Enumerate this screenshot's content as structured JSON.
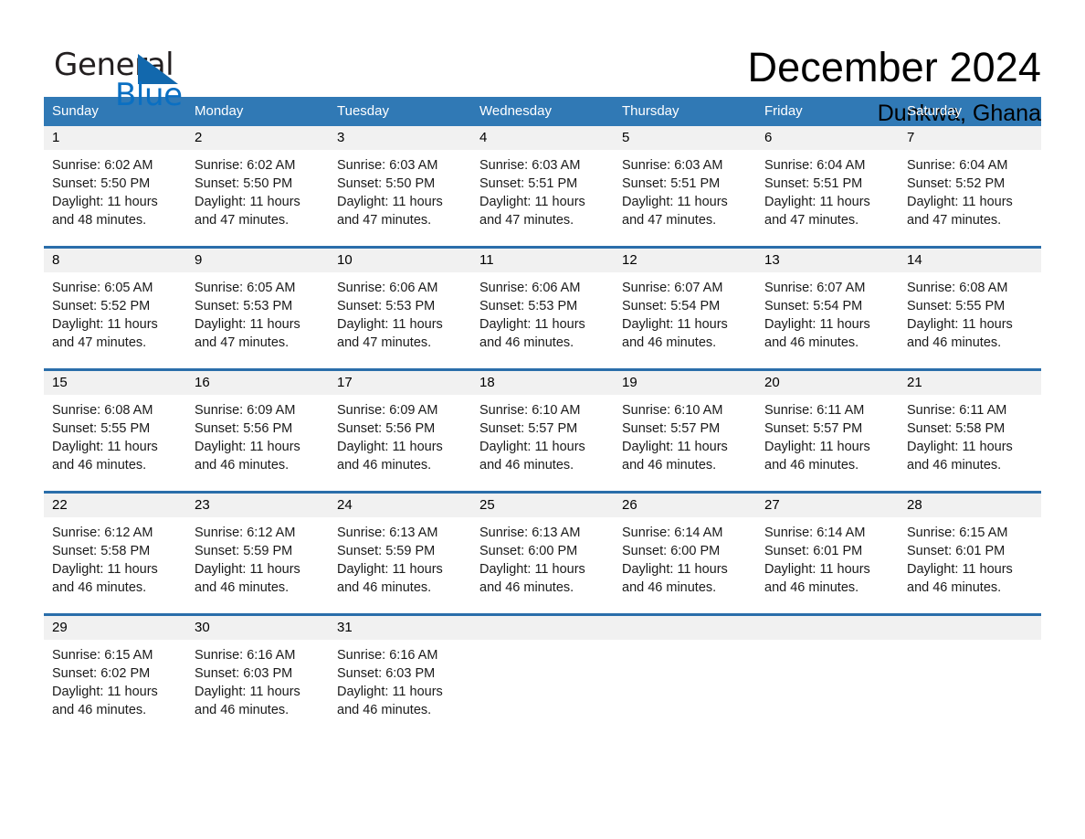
{
  "logo": {
    "text_primary": "General",
    "text_secondary": "Blue",
    "triangle_color": "#1268ad",
    "secondary_color": "#0a6fc2"
  },
  "header": {
    "title": "December 2024",
    "subtitle": "Dunkwa, Ghana"
  },
  "theme": {
    "header_blue": "#3079b5",
    "row_divider_blue": "#2a6eaa",
    "day_band_gray": "#f1f1f1"
  },
  "calendar": {
    "weekdays": [
      "Sunday",
      "Monday",
      "Tuesday",
      "Wednesday",
      "Thursday",
      "Friday",
      "Saturday"
    ],
    "weeks": [
      [
        {
          "day": "1",
          "sunrise": "Sunrise: 6:02 AM",
          "sunset": "Sunset: 5:50 PM",
          "daylight_1": "Daylight: 11 hours",
          "daylight_2": "and 48 minutes."
        },
        {
          "day": "2",
          "sunrise": "Sunrise: 6:02 AM",
          "sunset": "Sunset: 5:50 PM",
          "daylight_1": "Daylight: 11 hours",
          "daylight_2": "and 47 minutes."
        },
        {
          "day": "3",
          "sunrise": "Sunrise: 6:03 AM",
          "sunset": "Sunset: 5:50 PM",
          "daylight_1": "Daylight: 11 hours",
          "daylight_2": "and 47 minutes."
        },
        {
          "day": "4",
          "sunrise": "Sunrise: 6:03 AM",
          "sunset": "Sunset: 5:51 PM",
          "daylight_1": "Daylight: 11 hours",
          "daylight_2": "and 47 minutes."
        },
        {
          "day": "5",
          "sunrise": "Sunrise: 6:03 AM",
          "sunset": "Sunset: 5:51 PM",
          "daylight_1": "Daylight: 11 hours",
          "daylight_2": "and 47 minutes."
        },
        {
          "day": "6",
          "sunrise": "Sunrise: 6:04 AM",
          "sunset": "Sunset: 5:51 PM",
          "daylight_1": "Daylight: 11 hours",
          "daylight_2": "and 47 minutes."
        },
        {
          "day": "7",
          "sunrise": "Sunrise: 6:04 AM",
          "sunset": "Sunset: 5:52 PM",
          "daylight_1": "Daylight: 11 hours",
          "daylight_2": "and 47 minutes."
        }
      ],
      [
        {
          "day": "8",
          "sunrise": "Sunrise: 6:05 AM",
          "sunset": "Sunset: 5:52 PM",
          "daylight_1": "Daylight: 11 hours",
          "daylight_2": "and 47 minutes."
        },
        {
          "day": "9",
          "sunrise": "Sunrise: 6:05 AM",
          "sunset": "Sunset: 5:53 PM",
          "daylight_1": "Daylight: 11 hours",
          "daylight_2": "and 47 minutes."
        },
        {
          "day": "10",
          "sunrise": "Sunrise: 6:06 AM",
          "sunset": "Sunset: 5:53 PM",
          "daylight_1": "Daylight: 11 hours",
          "daylight_2": "and 47 minutes."
        },
        {
          "day": "11",
          "sunrise": "Sunrise: 6:06 AM",
          "sunset": "Sunset: 5:53 PM",
          "daylight_1": "Daylight: 11 hours",
          "daylight_2": "and 46 minutes."
        },
        {
          "day": "12",
          "sunrise": "Sunrise: 6:07 AM",
          "sunset": "Sunset: 5:54 PM",
          "daylight_1": "Daylight: 11 hours",
          "daylight_2": "and 46 minutes."
        },
        {
          "day": "13",
          "sunrise": "Sunrise: 6:07 AM",
          "sunset": "Sunset: 5:54 PM",
          "daylight_1": "Daylight: 11 hours",
          "daylight_2": "and 46 minutes."
        },
        {
          "day": "14",
          "sunrise": "Sunrise: 6:08 AM",
          "sunset": "Sunset: 5:55 PM",
          "daylight_1": "Daylight: 11 hours",
          "daylight_2": "and 46 minutes."
        }
      ],
      [
        {
          "day": "15",
          "sunrise": "Sunrise: 6:08 AM",
          "sunset": "Sunset: 5:55 PM",
          "daylight_1": "Daylight: 11 hours",
          "daylight_2": "and 46 minutes."
        },
        {
          "day": "16",
          "sunrise": "Sunrise: 6:09 AM",
          "sunset": "Sunset: 5:56 PM",
          "daylight_1": "Daylight: 11 hours",
          "daylight_2": "and 46 minutes."
        },
        {
          "day": "17",
          "sunrise": "Sunrise: 6:09 AM",
          "sunset": "Sunset: 5:56 PM",
          "daylight_1": "Daylight: 11 hours",
          "daylight_2": "and 46 minutes."
        },
        {
          "day": "18",
          "sunrise": "Sunrise: 6:10 AM",
          "sunset": "Sunset: 5:57 PM",
          "daylight_1": "Daylight: 11 hours",
          "daylight_2": "and 46 minutes."
        },
        {
          "day": "19",
          "sunrise": "Sunrise: 6:10 AM",
          "sunset": "Sunset: 5:57 PM",
          "daylight_1": "Daylight: 11 hours",
          "daylight_2": "and 46 minutes."
        },
        {
          "day": "20",
          "sunrise": "Sunrise: 6:11 AM",
          "sunset": "Sunset: 5:57 PM",
          "daylight_1": "Daylight: 11 hours",
          "daylight_2": "and 46 minutes."
        },
        {
          "day": "21",
          "sunrise": "Sunrise: 6:11 AM",
          "sunset": "Sunset: 5:58 PM",
          "daylight_1": "Daylight: 11 hours",
          "daylight_2": "and 46 minutes."
        }
      ],
      [
        {
          "day": "22",
          "sunrise": "Sunrise: 6:12 AM",
          "sunset": "Sunset: 5:58 PM",
          "daylight_1": "Daylight: 11 hours",
          "daylight_2": "and 46 minutes."
        },
        {
          "day": "23",
          "sunrise": "Sunrise: 6:12 AM",
          "sunset": "Sunset: 5:59 PM",
          "daylight_1": "Daylight: 11 hours",
          "daylight_2": "and 46 minutes."
        },
        {
          "day": "24",
          "sunrise": "Sunrise: 6:13 AM",
          "sunset": "Sunset: 5:59 PM",
          "daylight_1": "Daylight: 11 hours",
          "daylight_2": "and 46 minutes."
        },
        {
          "day": "25",
          "sunrise": "Sunrise: 6:13 AM",
          "sunset": "Sunset: 6:00 PM",
          "daylight_1": "Daylight: 11 hours",
          "daylight_2": "and 46 minutes."
        },
        {
          "day": "26",
          "sunrise": "Sunrise: 6:14 AM",
          "sunset": "Sunset: 6:00 PM",
          "daylight_1": "Daylight: 11 hours",
          "daylight_2": "and 46 minutes."
        },
        {
          "day": "27",
          "sunrise": "Sunrise: 6:14 AM",
          "sunset": "Sunset: 6:01 PM",
          "daylight_1": "Daylight: 11 hours",
          "daylight_2": "and 46 minutes."
        },
        {
          "day": "28",
          "sunrise": "Sunrise: 6:15 AM",
          "sunset": "Sunset: 6:01 PM",
          "daylight_1": "Daylight: 11 hours",
          "daylight_2": "and 46 minutes."
        }
      ],
      [
        {
          "day": "29",
          "sunrise": "Sunrise: 6:15 AM",
          "sunset": "Sunset: 6:02 PM",
          "daylight_1": "Daylight: 11 hours",
          "daylight_2": "and 46 minutes."
        },
        {
          "day": "30",
          "sunrise": "Sunrise: 6:16 AM",
          "sunset": "Sunset: 6:03 PM",
          "daylight_1": "Daylight: 11 hours",
          "daylight_2": "and 46 minutes."
        },
        {
          "day": "31",
          "sunrise": "Sunrise: 6:16 AM",
          "sunset": "Sunset: 6:03 PM",
          "daylight_1": "Daylight: 11 hours",
          "daylight_2": "and 46 minutes."
        },
        {
          "day": "",
          "sunrise": "",
          "sunset": "",
          "daylight_1": "",
          "daylight_2": ""
        },
        {
          "day": "",
          "sunrise": "",
          "sunset": "",
          "daylight_1": "",
          "daylight_2": ""
        },
        {
          "day": "",
          "sunrise": "",
          "sunset": "",
          "daylight_1": "",
          "daylight_2": ""
        },
        {
          "day": "",
          "sunrise": "",
          "sunset": "",
          "daylight_1": "",
          "daylight_2": ""
        }
      ]
    ]
  }
}
